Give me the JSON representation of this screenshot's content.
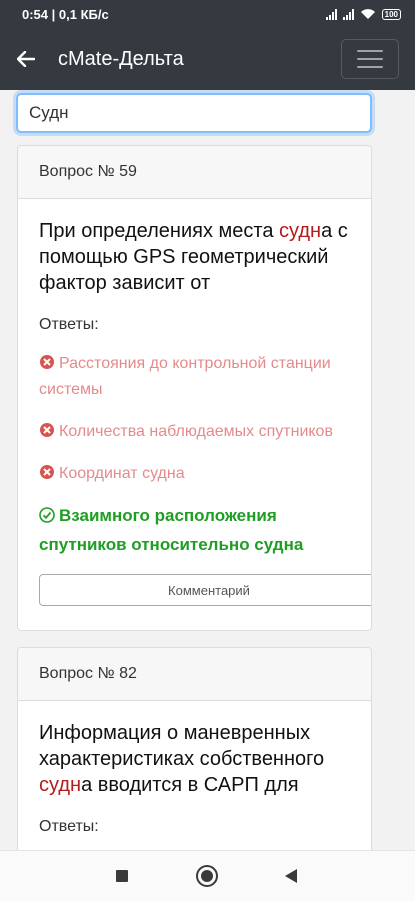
{
  "status_bar": {
    "time_speed": "0:54 | 0,1 КБ/с",
    "battery": "100"
  },
  "app_bar": {
    "title": "cMate-Дельта"
  },
  "search": {
    "value": "Судн"
  },
  "cards": [
    {
      "header": "Вопрос № 59",
      "question_parts": [
        "При определениях места ",
        "судн",
        "а с помощью GPS геометрический фактор зависит от"
      ],
      "answers_label": "Ответы:",
      "answers": [
        {
          "text": "Расстояния до контрольной станции системы",
          "correct": false
        },
        {
          "text": "Количества наблюдаемых спутников",
          "correct": false
        },
        {
          "text": "Координат судна",
          "correct": false
        },
        {
          "text": "Взаимного расположения спутников относительно судна",
          "correct": true
        }
      ],
      "comment_button": "Комментарий"
    },
    {
      "header": "Вопрос № 82",
      "question_parts": [
        "Информация о маневренных характеристиках собственного ",
        "судн",
        "а вводится в САРП для"
      ],
      "answers_label": "Ответы:"
    }
  ],
  "colors": {
    "highlight": "#b51b1b",
    "wrong": "#e58a8a",
    "correct": "#1e9e22",
    "app_bar": "#343a40"
  },
  "icons": {
    "back": "arrow-left-icon",
    "menu": "hamburger-menu-icon",
    "wrong": "x-circle-icon",
    "right": "check-circle-icon"
  }
}
